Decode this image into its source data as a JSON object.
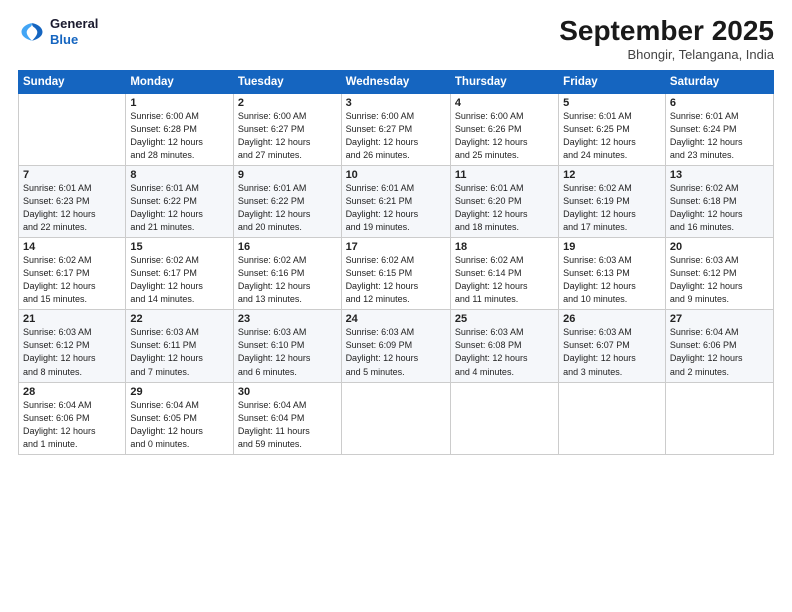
{
  "logo": {
    "line1": "General",
    "line2": "Blue"
  },
  "title": "September 2025",
  "subtitle": "Bhongir, Telangana, India",
  "weekdays": [
    "Sunday",
    "Monday",
    "Tuesday",
    "Wednesday",
    "Thursday",
    "Friday",
    "Saturday"
  ],
  "weeks": [
    [
      {
        "day": "",
        "info": ""
      },
      {
        "day": "1",
        "info": "Sunrise: 6:00 AM\nSunset: 6:28 PM\nDaylight: 12 hours\nand 28 minutes."
      },
      {
        "day": "2",
        "info": "Sunrise: 6:00 AM\nSunset: 6:27 PM\nDaylight: 12 hours\nand 27 minutes."
      },
      {
        "day": "3",
        "info": "Sunrise: 6:00 AM\nSunset: 6:27 PM\nDaylight: 12 hours\nand 26 minutes."
      },
      {
        "day": "4",
        "info": "Sunrise: 6:00 AM\nSunset: 6:26 PM\nDaylight: 12 hours\nand 25 minutes."
      },
      {
        "day": "5",
        "info": "Sunrise: 6:01 AM\nSunset: 6:25 PM\nDaylight: 12 hours\nand 24 minutes."
      },
      {
        "day": "6",
        "info": "Sunrise: 6:01 AM\nSunset: 6:24 PM\nDaylight: 12 hours\nand 23 minutes."
      }
    ],
    [
      {
        "day": "7",
        "info": "Sunrise: 6:01 AM\nSunset: 6:23 PM\nDaylight: 12 hours\nand 22 minutes."
      },
      {
        "day": "8",
        "info": "Sunrise: 6:01 AM\nSunset: 6:22 PM\nDaylight: 12 hours\nand 21 minutes."
      },
      {
        "day": "9",
        "info": "Sunrise: 6:01 AM\nSunset: 6:22 PM\nDaylight: 12 hours\nand 20 minutes."
      },
      {
        "day": "10",
        "info": "Sunrise: 6:01 AM\nSunset: 6:21 PM\nDaylight: 12 hours\nand 19 minutes."
      },
      {
        "day": "11",
        "info": "Sunrise: 6:01 AM\nSunset: 6:20 PM\nDaylight: 12 hours\nand 18 minutes."
      },
      {
        "day": "12",
        "info": "Sunrise: 6:02 AM\nSunset: 6:19 PM\nDaylight: 12 hours\nand 17 minutes."
      },
      {
        "day": "13",
        "info": "Sunrise: 6:02 AM\nSunset: 6:18 PM\nDaylight: 12 hours\nand 16 minutes."
      }
    ],
    [
      {
        "day": "14",
        "info": "Sunrise: 6:02 AM\nSunset: 6:17 PM\nDaylight: 12 hours\nand 15 minutes."
      },
      {
        "day": "15",
        "info": "Sunrise: 6:02 AM\nSunset: 6:17 PM\nDaylight: 12 hours\nand 14 minutes."
      },
      {
        "day": "16",
        "info": "Sunrise: 6:02 AM\nSunset: 6:16 PM\nDaylight: 12 hours\nand 13 minutes."
      },
      {
        "day": "17",
        "info": "Sunrise: 6:02 AM\nSunset: 6:15 PM\nDaylight: 12 hours\nand 12 minutes."
      },
      {
        "day": "18",
        "info": "Sunrise: 6:02 AM\nSunset: 6:14 PM\nDaylight: 12 hours\nand 11 minutes."
      },
      {
        "day": "19",
        "info": "Sunrise: 6:03 AM\nSunset: 6:13 PM\nDaylight: 12 hours\nand 10 minutes."
      },
      {
        "day": "20",
        "info": "Sunrise: 6:03 AM\nSunset: 6:12 PM\nDaylight: 12 hours\nand 9 minutes."
      }
    ],
    [
      {
        "day": "21",
        "info": "Sunrise: 6:03 AM\nSunset: 6:12 PM\nDaylight: 12 hours\nand 8 minutes."
      },
      {
        "day": "22",
        "info": "Sunrise: 6:03 AM\nSunset: 6:11 PM\nDaylight: 12 hours\nand 7 minutes."
      },
      {
        "day": "23",
        "info": "Sunrise: 6:03 AM\nSunset: 6:10 PM\nDaylight: 12 hours\nand 6 minutes."
      },
      {
        "day": "24",
        "info": "Sunrise: 6:03 AM\nSunset: 6:09 PM\nDaylight: 12 hours\nand 5 minutes."
      },
      {
        "day": "25",
        "info": "Sunrise: 6:03 AM\nSunset: 6:08 PM\nDaylight: 12 hours\nand 4 minutes."
      },
      {
        "day": "26",
        "info": "Sunrise: 6:03 AM\nSunset: 6:07 PM\nDaylight: 12 hours\nand 3 minutes."
      },
      {
        "day": "27",
        "info": "Sunrise: 6:04 AM\nSunset: 6:06 PM\nDaylight: 12 hours\nand 2 minutes."
      }
    ],
    [
      {
        "day": "28",
        "info": "Sunrise: 6:04 AM\nSunset: 6:06 PM\nDaylight: 12 hours\nand 1 minute."
      },
      {
        "day": "29",
        "info": "Sunrise: 6:04 AM\nSunset: 6:05 PM\nDaylight: 12 hours\nand 0 minutes."
      },
      {
        "day": "30",
        "info": "Sunrise: 6:04 AM\nSunset: 6:04 PM\nDaylight: 11 hours\nand 59 minutes."
      },
      {
        "day": "",
        "info": ""
      },
      {
        "day": "",
        "info": ""
      },
      {
        "day": "",
        "info": ""
      },
      {
        "day": "",
        "info": ""
      }
    ]
  ]
}
